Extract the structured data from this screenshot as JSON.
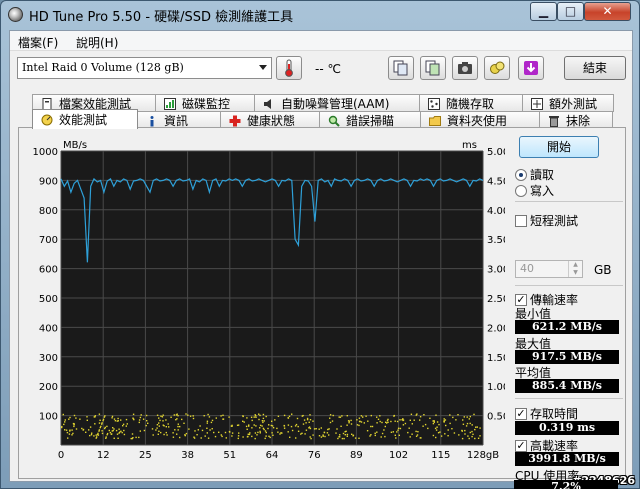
{
  "window": {
    "title": "HD Tune Pro 5.50 - 硬碟/SSD 檢測維護工具"
  },
  "menu": [
    {
      "label": "檔案(F)"
    },
    {
      "label": "說明(H)"
    }
  ],
  "toolbar": {
    "drive": "Intel   Raid 0 Volume (128 gB)",
    "temperature": "-- ℃",
    "exit_label": "結束",
    "icons": [
      "thermometer-icon",
      "copy-info-icon",
      "copy-image-icon",
      "camera-icon",
      "options-icon",
      "download-icon"
    ]
  },
  "tabs_top": [
    {
      "label": "檔案效能測試",
      "icon": "file-benchmark-icon"
    },
    {
      "label": "磁碟監控",
      "icon": "disk-monitor-icon"
    },
    {
      "label": "自動噪聲管理(AAM)",
      "icon": "speaker-icon"
    },
    {
      "label": "隨機存取",
      "icon": "random-access-icon"
    },
    {
      "label": "額外測試",
      "icon": "extra-tests-icon"
    }
  ],
  "tabs_bottom": [
    {
      "label": "效能測試",
      "icon": "benchmark-icon",
      "active": true
    },
    {
      "label": "資訊",
      "icon": "info-icon"
    },
    {
      "label": "健康狀態",
      "icon": "health-icon"
    },
    {
      "label": "錯誤掃瞄",
      "icon": "error-scan-icon"
    },
    {
      "label": "資料夾使用",
      "icon": "folder-icon"
    },
    {
      "label": "抹除",
      "icon": "erase-icon"
    }
  ],
  "controls": {
    "start_label": "開始",
    "read_label": "讀取",
    "write_label": "寫入",
    "mode": "read",
    "short_test_label": "短程測試",
    "short_test_checked": false,
    "short_test_size": "40",
    "size_unit": "GB",
    "transfer_rate_label": "傳輸速率",
    "transfer_rate_checked": true,
    "min_label": "最小值",
    "min_value": "621.2 MB/s",
    "max_label": "最大值",
    "max_value": "917.5 MB/s",
    "avg_label": "平均值",
    "avg_value": "885.4 MB/s",
    "access_time_label": "存取時間",
    "access_time_checked": true,
    "access_time_value": "0.319 ms",
    "burst_rate_label": "高載速率",
    "burst_rate_checked": true,
    "burst_rate_value": "3991.8 MB/s",
    "cpu_label": "CPU 使用率",
    "cpu_value": "7.2%"
  },
  "watermark": "#2248626",
  "chart_data": {
    "type": "line",
    "y_left_label": "MB/s",
    "y_right_label": "ms",
    "ylim": [
      0,
      1000
    ],
    "y2lim": [
      0,
      5
    ],
    "xlim": [
      0,
      128
    ],
    "x_unit": "gB",
    "grid": true,
    "x_ticks": [
      "0",
      "12",
      "25",
      "38",
      "51",
      "64",
      "76",
      "89",
      "102",
      "115",
      "128gB"
    ],
    "y_ticks": [
      "1000",
      "900",
      "800",
      "700",
      "600",
      "500",
      "400",
      "300",
      "200",
      "100"
    ],
    "y2_ticks": [
      "5.00",
      "4.50",
      "4.00",
      "3.50",
      "3.00",
      "2.50",
      "2.00",
      "1.50",
      "1.00",
      "0.50"
    ],
    "transfer_rate": {
      "x": [
        0,
        1,
        2,
        3,
        4,
        5,
        6,
        7,
        8,
        9,
        10,
        11,
        12,
        13,
        14,
        15,
        16,
        17,
        18,
        19,
        20,
        21,
        22,
        23,
        24,
        25,
        26,
        27,
        28,
        29,
        30,
        31,
        32,
        33,
        34,
        35,
        36,
        37,
        38,
        39,
        40,
        41,
        42,
        43,
        44,
        45,
        46,
        47,
        48,
        49,
        50,
        51,
        52,
        53,
        54,
        55,
        56,
        57,
        58,
        59,
        60,
        61,
        62,
        63,
        64,
        65,
        66,
        67,
        68,
        69,
        70,
        71,
        72,
        73,
        74,
        75,
        76,
        77,
        78,
        79,
        80,
        81,
        82,
        83,
        84,
        85,
        86,
        87,
        88,
        89,
        90,
        91,
        92,
        93,
        94,
        95,
        96,
        97,
        98,
        99,
        100,
        101,
        102,
        103,
        104,
        105,
        106,
        107,
        108,
        109,
        110,
        111,
        112,
        113,
        114,
        115,
        116,
        117,
        118,
        119,
        120,
        121,
        122,
        123,
        124,
        125,
        126,
        127,
        128
      ],
      "y": [
        905,
        880,
        898,
        860,
        890,
        900,
        870,
        840,
        621,
        880,
        905,
        895,
        900,
        860,
        898,
        905,
        880,
        900,
        895,
        905,
        900,
        870,
        898,
        900,
        905,
        900,
        880,
        860,
        900,
        905,
        898,
        900,
        905,
        900,
        880,
        900,
        905,
        898,
        900,
        905,
        870,
        900,
        895,
        905,
        900,
        860,
        900,
        905,
        880,
        900,
        898,
        905,
        900,
        905,
        900,
        880,
        900,
        905,
        898,
        900,
        905,
        900,
        895,
        900,
        905,
        900,
        880,
        900,
        898,
        905,
        900,
        700,
        680,
        880,
        900,
        898,
        880,
        760,
        900,
        905,
        895,
        900,
        880,
        905,
        900,
        898,
        905,
        900,
        880,
        900,
        905,
        898,
        900,
        905,
        900,
        880,
        900,
        905,
        898,
        900,
        905,
        900,
        895,
        900,
        905,
        900,
        880,
        900,
        898,
        905,
        900,
        905,
        900,
        880,
        900,
        905,
        898,
        900,
        905,
        900,
        895,
        900,
        905,
        900,
        880,
        900,
        898,
        905,
        900
      ]
    },
    "access_time_ms": [
      0.319
    ],
    "burst_rate_mbs": [
      3991.8
    ]
  }
}
